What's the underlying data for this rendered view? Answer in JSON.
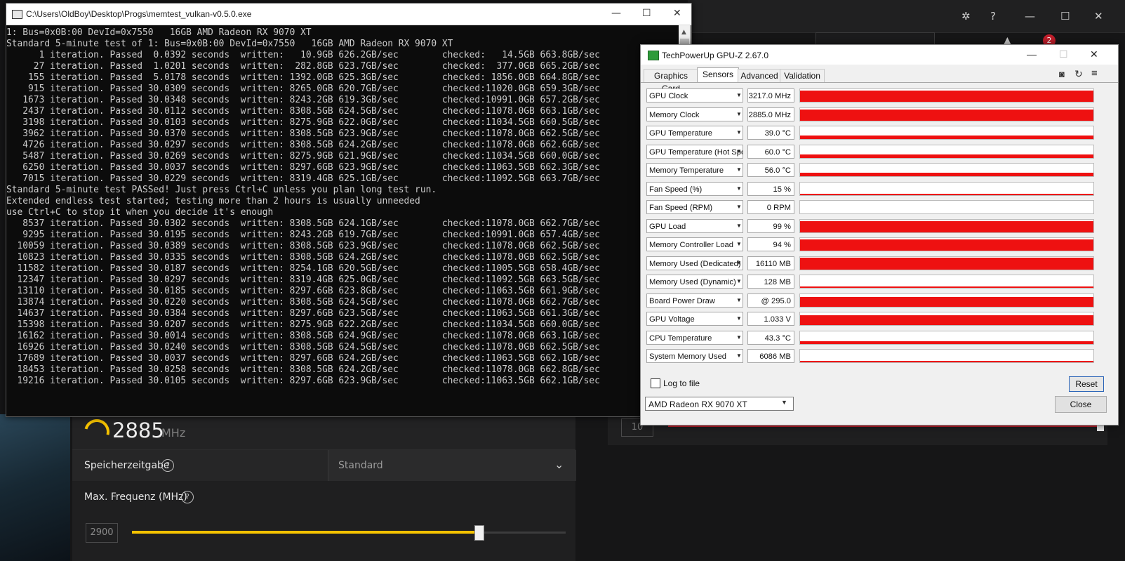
{
  "background_app": {
    "frequency_value": "2885",
    "frequency_unit": "MHz",
    "memory_timing_label": "Speicherzeitgabe",
    "memory_timing_value": "Standard",
    "max_frequency_label": "Max. Frequenz (MHz)",
    "max_frequency_input": "2900",
    "max_frequency_slider_fraction": 0.8,
    "right_input": "10",
    "notification_count": "2",
    "help_glyph": "?"
  },
  "console": {
    "title": "C:\\Users\\OldBoy\\Desktop\\Progs\\memtest_vulkan-v0.5.0.exe",
    "lines": [
      "1: Bus=0x0B:00 DevId=0x7550   16GB AMD Radeon RX 9070 XT",
      "Standard 5-minute test of 1: Bus=0x0B:00 DevId=0x7550   16GB AMD Radeon RX 9070 XT",
      "      1 iteration. Passed  0.0392 seconds  written:   10.9GB 626.2GB/sec        checked:   14.5GB 663.8GB/sec",
      "     27 iteration. Passed  1.0201 seconds  written:  282.8GB 623.7GB/sec        checked:  377.0GB 665.2GB/sec",
      "    155 iteration. Passed  5.0178 seconds  written: 1392.0GB 625.3GB/sec        checked: 1856.0GB 664.8GB/sec",
      "    915 iteration. Passed 30.0309 seconds  written: 8265.0GB 620.7GB/sec        checked:11020.0GB 659.3GB/sec",
      "   1673 iteration. Passed 30.0348 seconds  written: 8243.2GB 619.3GB/sec        checked:10991.0GB 657.2GB/sec",
      "   2437 iteration. Passed 30.0112 seconds  written: 8308.5GB 624.5GB/sec        checked:11078.0GB 663.1GB/sec",
      "   3198 iteration. Passed 30.0103 seconds  written: 8275.9GB 622.0GB/sec        checked:11034.5GB 660.5GB/sec",
      "   3962 iteration. Passed 30.0370 seconds  written: 8308.5GB 623.9GB/sec        checked:11078.0GB 662.5GB/sec",
      "   4726 iteration. Passed 30.0297 seconds  written: 8308.5GB 624.2GB/sec        checked:11078.0GB 662.6GB/sec",
      "   5487 iteration. Passed 30.0269 seconds  written: 8275.9GB 621.9GB/sec        checked:11034.5GB 660.0GB/sec",
      "   6250 iteration. Passed 30.0037 seconds  written: 8297.6GB 623.9GB/sec        checked:11063.5GB 662.3GB/sec",
      "   7015 iteration. Passed 30.0229 seconds  written: 8319.4GB 625.1GB/sec        checked:11092.5GB 663.7GB/sec",
      "Standard 5-minute test PASSed! Just press Ctrl+C unless you plan long test run.",
      "Extended endless test started; testing more than 2 hours is usually unneeded",
      "use Ctrl+C to stop it when you decide it's enough",
      "   8537 iteration. Passed 30.0302 seconds  written: 8308.5GB 624.1GB/sec        checked:11078.0GB 662.7GB/sec",
      "   9295 iteration. Passed 30.0195 seconds  written: 8243.2GB 619.7GB/sec        checked:10991.0GB 657.4GB/sec",
      "  10059 iteration. Passed 30.0389 seconds  written: 8308.5GB 623.9GB/sec        checked:11078.0GB 662.5GB/sec",
      "  10823 iteration. Passed 30.0335 seconds  written: 8308.5GB 624.2GB/sec        checked:11078.0GB 662.5GB/sec",
      "  11582 iteration. Passed 30.0187 seconds  written: 8254.1GB 620.5GB/sec        checked:11005.5GB 658.4GB/sec",
      "  12347 iteration. Passed 30.0297 seconds  written: 8319.4GB 625.0GB/sec        checked:11092.5GB 663.5GB/sec",
      "  13110 iteration. Passed 30.0185 seconds  written: 8297.6GB 623.8GB/sec        checked:11063.5GB 661.9GB/sec",
      "  13874 iteration. Passed 30.0220 seconds  written: 8308.5GB 624.5GB/sec        checked:11078.0GB 662.7GB/sec",
      "  14637 iteration. Passed 30.0384 seconds  written: 8297.6GB 623.5GB/sec        checked:11063.5GB 661.3GB/sec",
      "  15398 iteration. Passed 30.0207 seconds  written: 8275.9GB 622.2GB/sec        checked:11034.5GB 660.0GB/sec",
      "  16162 iteration. Passed 30.0014 seconds  written: 8308.5GB 624.9GB/sec        checked:11078.0GB 663.1GB/sec",
      "  16926 iteration. Passed 30.0240 seconds  written: 8308.5GB 624.5GB/sec        checked:11078.0GB 662.5GB/sec",
      "  17689 iteration. Passed 30.0037 seconds  written: 8297.6GB 624.2GB/sec        checked:11063.5GB 662.1GB/sec",
      "  18453 iteration. Passed 30.0258 seconds  written: 8308.5GB 624.2GB/sec        checked:11078.0GB 662.8GB/sec",
      "  19216 iteration. Passed 30.0105 seconds  written: 8297.6GB 623.9GB/sec        checked:11063.5GB 662.1GB/sec"
    ]
  },
  "gpuz": {
    "title": "TechPowerUp GPU-Z 2.67.0",
    "tabs": [
      "Graphics Card",
      "Sensors",
      "Advanced",
      "Validation"
    ],
    "active_tab": "Sensors",
    "sensors": [
      {
        "name": "GPU Clock",
        "value": "3217.0 MHz",
        "fill": 0.9
      },
      {
        "name": "Memory Clock",
        "value": "2885.0 MHz",
        "fill": 0.9
      },
      {
        "name": "GPU Temperature",
        "value": "39.0 °C",
        "fill": 0.25
      },
      {
        "name": "GPU Temperature (Hot Spot)",
        "value": "60.0 °C",
        "fill": 0.3
      },
      {
        "name": "Memory Temperature",
        "value": "56.0 °C",
        "fill": 0.3
      },
      {
        "name": "Fan Speed (%)",
        "value": "15 %",
        "fill": 0.1
      },
      {
        "name": "Fan Speed (RPM)",
        "value": "0 RPM",
        "fill": 0
      },
      {
        "name": "GPU Load",
        "value": "99 %",
        "fill": 0.9
      },
      {
        "name": "Memory Controller Load",
        "value": "94 %",
        "fill": 0.9
      },
      {
        "name": "Memory Used (Dedicated)",
        "value": "16110 MB",
        "fill": 0.95
      },
      {
        "name": "Memory Used (Dynamic)",
        "value": "128 MB",
        "fill": 0.03
      },
      {
        "name": "Board Power Draw",
        "value": "@ 295.0",
        "fill": 0.8
      },
      {
        "name": "GPU Voltage",
        "value": "1.033 V",
        "fill": 0.8
      },
      {
        "name": "CPU Temperature",
        "value": "43.3 °C",
        "fill": 0.22
      },
      {
        "name": "System Memory Used",
        "value": "6086 MB",
        "fill": 0.1
      }
    ],
    "log_to_file_label": "Log to file",
    "reset_label": "Reset",
    "gpu_select": "AMD Radeon RX 9070 XT",
    "close_label": "Close"
  }
}
